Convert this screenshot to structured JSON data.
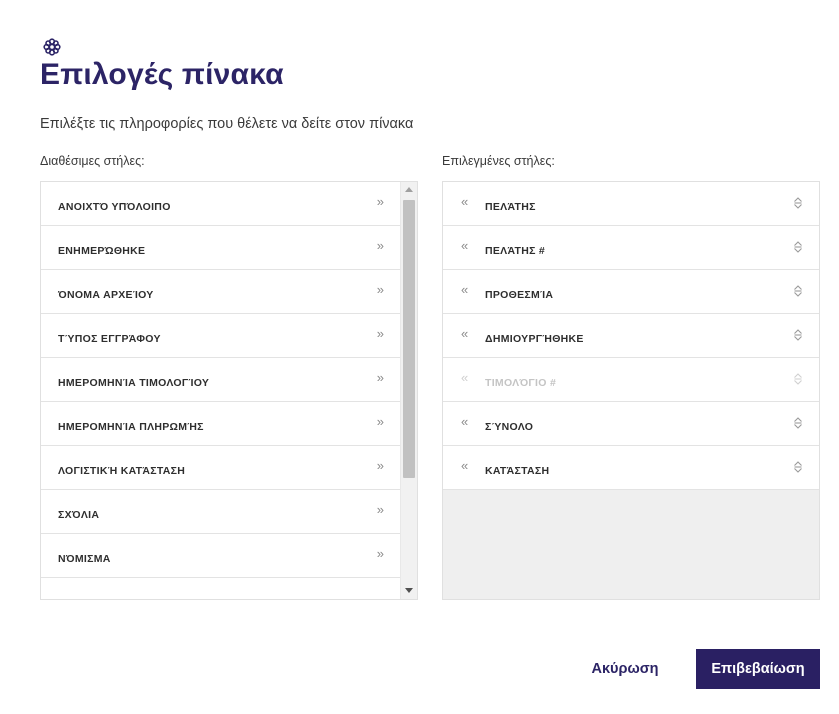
{
  "dialog": {
    "title": "Επιλογές πίνακα",
    "subtitle": "Επιλέξτε τις πληροφορίες που θέλετε να δείτε στον πίνακα",
    "icon": "gear-icon"
  },
  "available": {
    "label": "Διαθέσιμες στήλες:",
    "add_glyph": "»",
    "items": [
      {
        "label": "ΑΝΟΙΧΤΌ ΥΠΌΛΟΙΠΟ"
      },
      {
        "label": "ΕΝΗΜΕΡΏΘΗΚΕ"
      },
      {
        "label": "ΌΝΟΜΑ ΑΡΧΕΊΟΥ"
      },
      {
        "label": "ΤΎΠΟΣ ΕΓΓΡΆΦΟΥ"
      },
      {
        "label": "ΗΜΕΡΟΜΗΝΊΑ ΤΙΜΟΛΟΓΊΟΥ"
      },
      {
        "label": "ΗΜΕΡΟΜΗΝΊΑ ΠΛΗΡΩΜΉΣ"
      },
      {
        "label": "ΛΟΓΙΣΤΙΚΉ ΚΑΤΆΣΤΑΣΗ"
      },
      {
        "label": "ΣΧΌΛΙΑ"
      },
      {
        "label": "ΝΌΜΙΣΜΑ"
      }
    ]
  },
  "selected": {
    "label": "Επιλεγμένες στήλες:",
    "remove_glyph": "«",
    "items": [
      {
        "label": "ΠΕΛΆΤΗΣ",
        "disabled": false
      },
      {
        "label": "ΠΕΛΆΤΗΣ #",
        "disabled": false
      },
      {
        "label": "ΠΡΟΘΕΣΜΊΑ",
        "disabled": false
      },
      {
        "label": "ΔΗΜΙΟΥΡΓΉΘΗΚΕ",
        "disabled": false
      },
      {
        "label": "ΤΙΜΟΛΌΓΙΟ #",
        "disabled": true
      },
      {
        "label": "ΣΎΝΟΛΟ",
        "disabled": false
      },
      {
        "label": "ΚΑΤΆΣΤΑΣΗ",
        "disabled": false
      }
    ]
  },
  "footer": {
    "cancel_label": "Ακύρωση",
    "confirm_label": "Επιβεβαίωση"
  },
  "colors": {
    "accent": "#2a2063",
    "title": "#2c2466"
  }
}
